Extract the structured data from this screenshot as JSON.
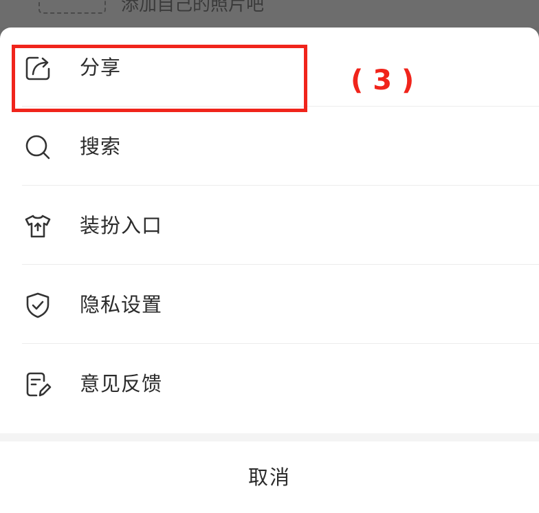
{
  "background": {
    "partial_text": "添加自己的照片吧"
  },
  "menu": {
    "items": [
      {
        "label": "分享",
        "icon": "share-icon"
      },
      {
        "label": "搜索",
        "icon": "search-icon"
      },
      {
        "label": "装扮入口",
        "icon": "tshirt-icon"
      },
      {
        "label": "隐私设置",
        "icon": "shield-check-icon"
      },
      {
        "label": "意见反馈",
        "icon": "feedback-edit-icon"
      }
    ],
    "cancel_label": "取消"
  },
  "annotation": {
    "step": "( 3 )",
    "color": "#f0241b"
  }
}
